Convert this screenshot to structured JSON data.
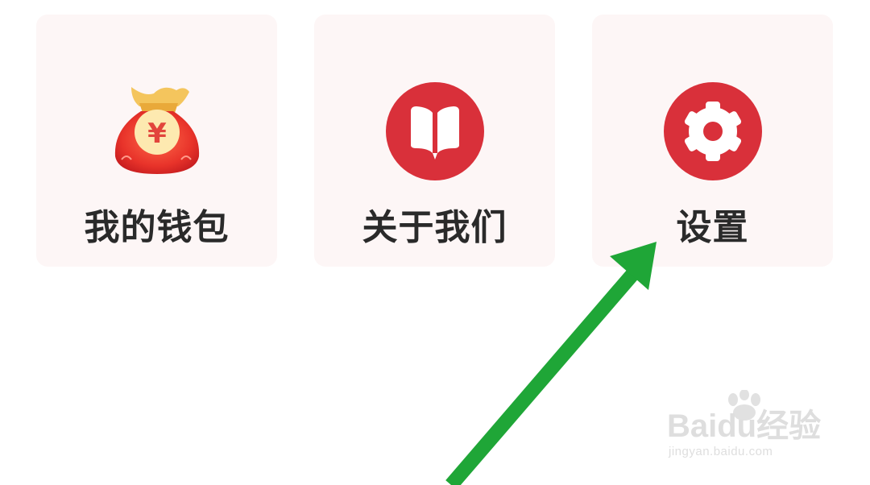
{
  "menu": {
    "items": [
      {
        "label": "我的钱包",
        "icon": "money-bag-icon"
      },
      {
        "label": "关于我们",
        "icon": "book-icon"
      },
      {
        "label": "设置",
        "icon": "gear-icon"
      }
    ]
  },
  "colors": {
    "card_bg": "#fdf6f6",
    "accent_red": "#d9303a",
    "arrow_green": "#1fa637",
    "text": "#2a2a2a"
  },
  "watermark": {
    "brand": "Baidu经验",
    "url": "jingyan.baidu.com"
  }
}
